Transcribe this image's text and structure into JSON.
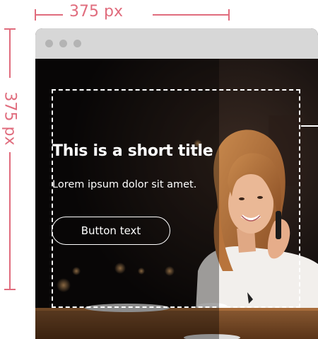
{
  "dimensions": {
    "width_label": "375 px",
    "height_label": "375 px",
    "color": "#e06c7d"
  },
  "browser": {
    "window_dots": [
      "dot",
      "dot",
      "dot"
    ]
  },
  "hero": {
    "title": "This is a short title",
    "subtitle": "Lorem ipsum dolor sit amet.",
    "button_label": "Button text",
    "image_description": "photo-woman-on-phone-in-cafe"
  }
}
